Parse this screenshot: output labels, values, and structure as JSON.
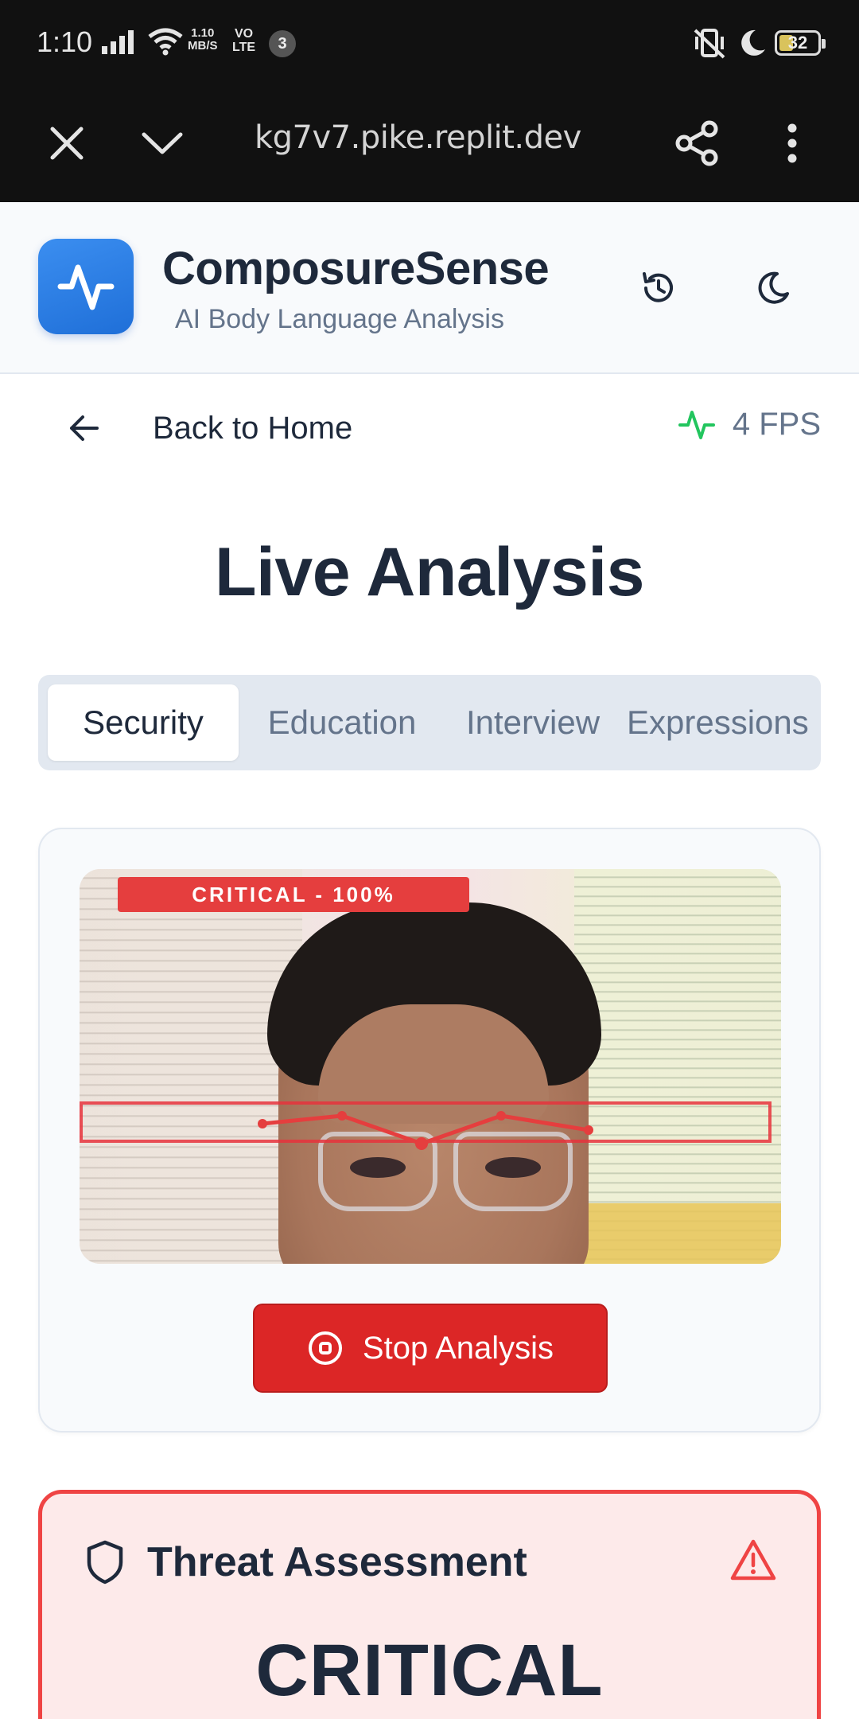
{
  "status_bar": {
    "time": "1:10",
    "speed_value": "1.10",
    "speed_unit": "MB/S",
    "volte_top": "VO",
    "volte_bottom": "LTE",
    "notification_count": "3",
    "battery": "32"
  },
  "browser": {
    "url": "kg7v7.pike.replit.dev"
  },
  "header": {
    "title": "ComposureSense",
    "subtitle": "AI Body Language Analysis"
  },
  "nav": {
    "back_label": "Back to Home",
    "fps": "4 FPS"
  },
  "page": {
    "title": "Live Analysis"
  },
  "tabs": [
    {
      "label": "Security",
      "active": true
    },
    {
      "label": "Education",
      "active": false
    },
    {
      "label": "Interview",
      "active": false
    },
    {
      "label": "Expressions",
      "active": false
    }
  ],
  "video": {
    "overlay_label": "CRITICAL - 100%"
  },
  "controls": {
    "stop_label": "Stop Analysis"
  },
  "threat": {
    "title": "Threat Assessment",
    "level": "CRITICAL"
  },
  "colors": {
    "brand_blue": "#2f80ed",
    "danger_red": "#dc2626",
    "fps_green": "#22c55e",
    "threat_bg": "#fdeaea"
  }
}
